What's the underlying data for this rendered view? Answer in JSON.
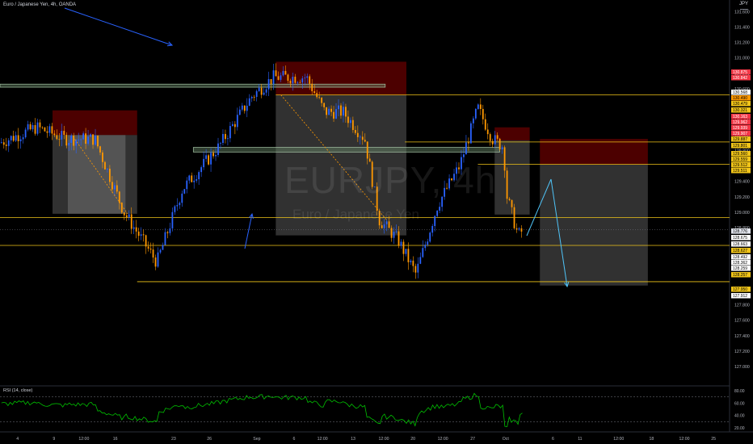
{
  "header": {
    "title": "Euro / Japanese Yen, 4h, OANDA",
    "symbol_short": "JPY"
  },
  "watermark": {
    "symbol": "EURJPY, 4h",
    "name": "Euro / Japanese Yen"
  },
  "rsi": {
    "label": "RSI (14, close)"
  },
  "colors": {
    "up": "#2962ff",
    "down": "#ff9800",
    "level": "#f0c419",
    "zone_red": "#8b0000",
    "zone_grey": "#b0b0b0",
    "zone_green": "#6a8c6a",
    "rsi": "#00c000",
    "arrow": "#2962ff",
    "projection": "#4fc3f7"
  },
  "chart_data": {
    "type": "candlestick",
    "x_ticks": [
      "4",
      "9",
      "12:00",
      "16",
      "23",
      "26",
      "Sep",
      "6",
      "12:00",
      "13",
      "12:00",
      "20",
      "12:00",
      "27",
      "Oct",
      "6",
      "11",
      "12:00",
      "18",
      "12:00",
      "25"
    ],
    "y_ticks": [
      "131.600",
      "131.400",
      "131.200",
      "131.000",
      "130.800",
      "130.600",
      "130.400",
      "130.200",
      "130.000",
      "129.800",
      "129.600",
      "129.400",
      "129.200",
      "129.000",
      "128.800",
      "128.600",
      "128.400",
      "128.200",
      "128.000",
      "127.800",
      "127.600",
      "127.400",
      "127.200",
      "127.000",
      "126.800"
    ],
    "ylim": [
      126.75,
      131.75
    ],
    "price_labels": [
      {
        "text": "130.875",
        "bg": "#f23645",
        "fg": "#ffffff"
      },
      {
        "text": "130.842",
        "bg": "#f23645",
        "fg": "#ffffff"
      },
      {
        "text": "130.568",
        "bg": "#ffffff",
        "fg": "#000000"
      },
      {
        "text": "130.490",
        "bg": "#ff9800",
        "fg": "#000000"
      },
      {
        "text": "130.479",
        "bg": "#f0c419",
        "fg": "#000000"
      },
      {
        "text": "130.321",
        "bg": "#f0c419",
        "fg": "#000000"
      },
      {
        "text": "130.163",
        "bg": "#f23645",
        "fg": "#ffffff"
      },
      {
        "text": "129.962",
        "bg": "#f23645",
        "fg": "#ffffff"
      },
      {
        "text": "129.939",
        "bg": "#f23645",
        "fg": "#ffffff"
      },
      {
        "text": "129.907",
        "bg": "#f23645",
        "fg": "#ffffff"
      },
      {
        "text": "129.887",
        "bg": "#f0c419",
        "fg": "#000000"
      },
      {
        "text": "129.801",
        "bg": "#f0c419",
        "fg": "#000000"
      },
      {
        "text": "129.560",
        "bg": "#f0c419",
        "fg": "#000000"
      },
      {
        "text": "129.559",
        "bg": "#f0c419",
        "fg": "#000000"
      },
      {
        "text": "129.512",
        "bg": "#f0c419",
        "fg": "#000000"
      },
      {
        "text": "129.511",
        "bg": "#f0c419",
        "fg": "#000000"
      },
      {
        "text": "128.776",
        "bg": "#e0e3eb",
        "fg": "#000000"
      },
      {
        "text": "128.675",
        "bg": "#ffffff",
        "fg": "#000000"
      },
      {
        "text": "128.663",
        "bg": "#ffffff",
        "fg": "#000000"
      },
      {
        "text": "128.627",
        "bg": "#f0c419",
        "fg": "#000000"
      },
      {
        "text": "128.492",
        "bg": "#ffffff",
        "fg": "#000000"
      },
      {
        "text": "128.362",
        "bg": "#ffffff",
        "fg": "#000000"
      },
      {
        "text": "128.259",
        "bg": "#ffffff",
        "fg": "#000000"
      },
      {
        "text": "128.257",
        "bg": "#f0c419",
        "fg": "#000000"
      },
      {
        "text": "127.950",
        "bg": "#f0c419",
        "fg": "#000000"
      },
      {
        "text": "127.912",
        "bg": "#ffffff",
        "fg": "#000000"
      }
    ],
    "horizontal_levels": [
      130.52,
      129.91,
      129.62,
      128.93,
      128.57,
      128.1
    ],
    "zones": [
      {
        "kind": "red",
        "x0": 0.072,
        "x1": 0.188,
        "y0": 130.32,
        "y1": 130.0
      },
      {
        "kind": "grey",
        "x0": 0.072,
        "x1": 0.172,
        "y0": 130.0,
        "y1": 128.98
      },
      {
        "kind": "grey",
        "x0": 0.188,
        "x1": 0.093,
        "y0": 130.0,
        "y1": 128.98
      },
      {
        "kind": "red",
        "x0": 0.378,
        "x1": 0.557,
        "y0": 130.95,
        "y1": 130.52
      },
      {
        "kind": "grey",
        "x0": 0.378,
        "x1": 0.557,
        "y0": 130.52,
        "y1": 128.7
      },
      {
        "kind": "red",
        "x0": 0.678,
        "x1": 0.726,
        "y0": 130.1,
        "y1": 129.93
      },
      {
        "kind": "grey",
        "x0": 0.678,
        "x1": 0.726,
        "y0": 129.93,
        "y1": 128.97
      },
      {
        "kind": "red",
        "x0": 0.74,
        "x1": 0.888,
        "y0": 129.95,
        "y1": 129.62
      },
      {
        "kind": "grey",
        "x0": 0.74,
        "x1": 0.888,
        "y0": 129.62,
        "y1": 128.05
      }
    ],
    "green_zones": [
      {
        "x0": 0.0,
        "x1": 0.528,
        "y0": 130.66,
        "y1": 130.62
      },
      {
        "x0": 0.265,
        "x1": 0.685,
        "y0": 129.84,
        "y1": 129.78
      }
    ],
    "rsi": {
      "ylim": [
        15,
        85
      ],
      "ticks": [
        "80.00",
        "60.00",
        "40.00",
        "20.00"
      ],
      "levels": [
        70,
        30
      ]
    }
  }
}
